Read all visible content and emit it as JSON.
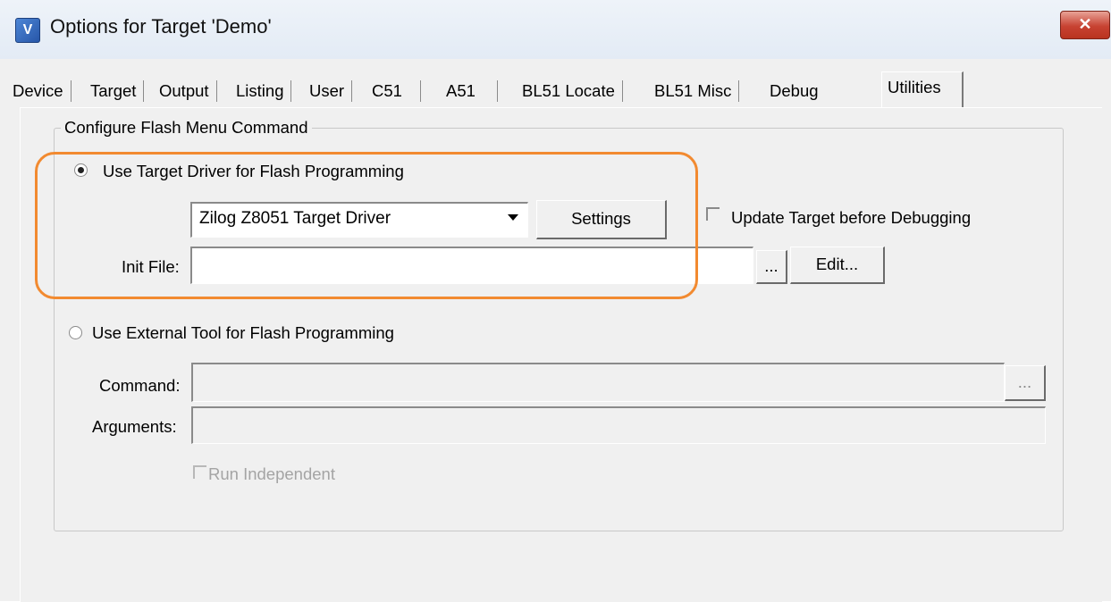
{
  "window": {
    "title": "Options for Target 'Demo'",
    "icon": "uvision-icon",
    "close_label": "✕"
  },
  "tabs": [
    "Device",
    "Target",
    "Output",
    "Listing",
    "User",
    "C51",
    "A51",
    "BL51 Locate",
    "BL51 Misc",
    "Debug",
    "Utilities"
  ],
  "active_tab": "Utilities",
  "group": {
    "label": "Configure Flash Menu Command"
  },
  "target_driver": {
    "radio_label": "Use Target Driver for Flash Programming",
    "selected": true,
    "driver_value": "Zilog Z8051 Target Driver",
    "settings_label": "Settings",
    "update_label": "Update Target before Debugging",
    "update_checked": false,
    "init_file_label": "Init File:",
    "init_file_value": "",
    "browse_label": "...",
    "edit_label": "Edit..."
  },
  "external_tool": {
    "radio_label": "Use External Tool for Flash Programming",
    "selected": false,
    "command_label": "Command:",
    "command_value": "",
    "browse_label": "...",
    "arguments_label": "Arguments:",
    "arguments_value": "",
    "run_independent_label": "Run Independent",
    "run_independent_checked": false
  },
  "colors": {
    "highlight": "#f28a30",
    "dialog_bg": "#f0f0f0",
    "close_button": "#c74232"
  }
}
